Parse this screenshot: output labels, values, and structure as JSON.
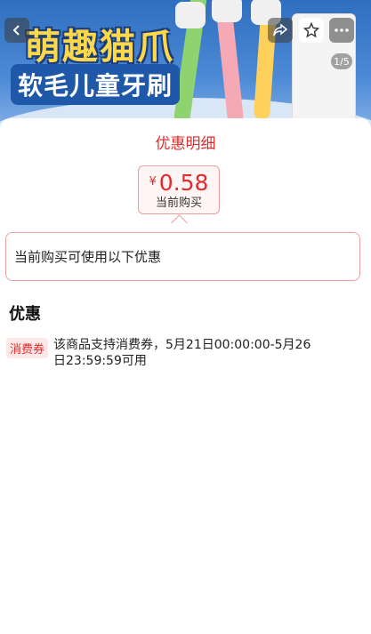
{
  "banner": {
    "title": "萌趣猫爪",
    "subtitle": "软毛儿童牙刷",
    "pager": "1/5"
  },
  "nav": {
    "back_icon": "chevron-left-icon",
    "share_icon": "share-icon",
    "favorite_icon": "star-icon",
    "more_icon": "more-dots-icon"
  },
  "sheet": {
    "title": "优惠明细",
    "price": {
      "currency": "¥",
      "amount": "0.58",
      "label": "当前购买"
    },
    "notice": "当前购买可使用以下优惠",
    "section_title": "优惠",
    "coupons": [
      {
        "tag": "消费券",
        "text": "该商品支持消费券，5月21日00:00:00-5月26日23:59:59可用"
      }
    ]
  },
  "colors": {
    "accent": "#e02d2d",
    "border": "#e8a0a0",
    "tag_bg": "#fde8e8"
  }
}
